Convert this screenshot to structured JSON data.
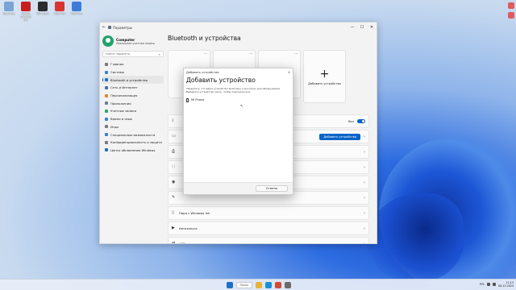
{
  "desktop": {
    "icons": [
      {
        "label": "Корзина",
        "color": "#7aa4d6"
      },
      {
        "label": "Adobe Acrobat DC",
        "color": "#c81e1e"
      },
      {
        "label": "Wordpad",
        "color": "#2b2b2b"
      },
      {
        "label": "OptiPlex",
        "color": "#d93434"
      },
      {
        "label": "OptiPlex",
        "color": "#3d7bd9"
      }
    ]
  },
  "window": {
    "title": "Параметры",
    "controls": {
      "minimize": "—",
      "maximize": "☐",
      "close": "✕"
    }
  },
  "profile": {
    "name": "Computer",
    "account": "Локальная учетная запись"
  },
  "search": {
    "placeholder": "Найти параметр"
  },
  "sidebar": {
    "items": [
      {
        "label": "Главная",
        "icon": "home-icon",
        "color": "#7a7a7a"
      },
      {
        "label": "Система",
        "icon": "system-icon",
        "color": "#3b82d4"
      },
      {
        "label": "Bluetooth и устройства",
        "icon": "bluetooth-icon",
        "color": "#1f6fc9",
        "active": true
      },
      {
        "label": "Сеть и Интернет",
        "icon": "network-icon",
        "color": "#4a6fa5"
      },
      {
        "label": "Персонализация",
        "icon": "personalization-icon",
        "color": "#d98a2b"
      },
      {
        "label": "Приложения",
        "icon": "apps-icon",
        "color": "#6b7a8f"
      },
      {
        "label": "Учетные записи",
        "icon": "accounts-icon",
        "color": "#2ea36a"
      },
      {
        "label": "Время и язык",
        "icon": "time-language-icon",
        "color": "#3b82d4"
      },
      {
        "label": "Игры",
        "icon": "gaming-icon",
        "color": "#7a7a7a"
      },
      {
        "label": "Специальные возможности",
        "icon": "accessibility-icon",
        "color": "#3b82d4"
      },
      {
        "label": "Конфиденциальность и защита",
        "icon": "privacy-icon",
        "color": "#7a7a7a"
      },
      {
        "label": "Центр обновления Windows",
        "icon": "update-icon",
        "color": "#1f6fc9"
      }
    ]
  },
  "main": {
    "title": "Bluetooth и устройства",
    "devices": [
      {
        "name": "SOUND"
      },
      {
        "name": ""
      },
      {
        "name": ""
      }
    ],
    "add_device_label": "Добавить устройство",
    "rows": [
      {
        "icon": "bluetooth-icon",
        "title": "",
        "sub": "",
        "right": "toggle",
        "toggle_label": "Вкл"
      },
      {
        "icon": "devices-icon",
        "title": "",
        "sub": "",
        "right": "button",
        "button_label": "Добавить устройство"
      },
      {
        "icon": "printer-icon",
        "title": "",
        "sub": "",
        "right": "chevron"
      },
      {
        "icon": "mouse-icon",
        "title": "",
        "sub": "",
        "right": "chevron"
      },
      {
        "icon": "camera-icon",
        "title": "",
        "sub": "",
        "right": "chevron"
      },
      {
        "icon": "pen-icon",
        "title": "",
        "sub": "",
        "right": "chevron"
      },
      {
        "icon": "phone-icon",
        "title": "Пара с Windows Ink",
        "sub": "",
        "right": "chevron"
      },
      {
        "icon": "autoplay-icon",
        "title": "Автозапуск",
        "sub": "",
        "right": "chevron"
      },
      {
        "icon": "usb-icon",
        "title": "USB",
        "sub": "",
        "right": "chevron"
      }
    ]
  },
  "dialog": {
    "bar_title": "Добавить устройство",
    "close": "✕",
    "title": "Добавить устройство",
    "text": "Убедитесь, что ваше устройство включено и доступно для обнаружения. Выберите устройство ниже, чтобы подключиться.",
    "devices": [
      {
        "name": "MI Phone"
      }
    ],
    "cancel_label": "Отмена"
  },
  "taskbar": {
    "search_label": "Поиск",
    "apps": [
      {
        "icon": "start-icon",
        "color": "#1f6fc9"
      },
      {
        "icon": "search-icon",
        "color": "#ffffff"
      },
      {
        "icon": "file-explorer-icon",
        "color": "#e8b33a"
      },
      {
        "icon": "edge-icon",
        "color": "#1a8fd8"
      },
      {
        "icon": "chrome-icon",
        "color": "#d24c3a"
      },
      {
        "icon": "settings-icon",
        "color": "#6b6b6b"
      }
    ],
    "time": "11:13",
    "date": "08.12.2024",
    "lang": "РУС"
  }
}
